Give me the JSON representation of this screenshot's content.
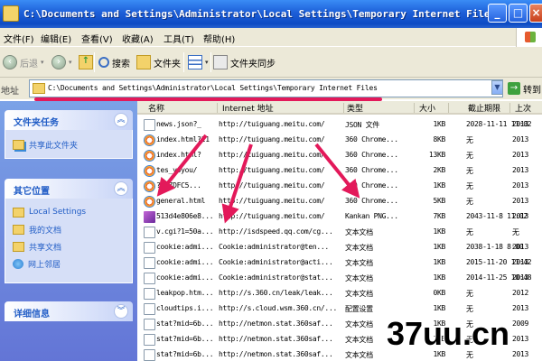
{
  "window": {
    "title": "C:\\Documents and Settings\\Administrator\\Local Settings\\Temporary Internet Files",
    "controls": {
      "minimize": "_",
      "maximize": "□",
      "close": "×"
    }
  },
  "menu": [
    "文件(F)",
    "编辑(E)",
    "查看(V)",
    "收藏(A)",
    "工具(T)",
    "帮助(H)"
  ],
  "toolbar": {
    "back_label": "后退",
    "search_label": "搜索",
    "folders_label": "文件夹",
    "sync_label": "文件夹同步"
  },
  "address": {
    "label": "地址",
    "path": "C:\\Documents and Settings\\Administrator\\Local Settings\\Temporary Internet Files",
    "go_label": "转到"
  },
  "left_pane": {
    "tasks": {
      "title": "文件夹任务",
      "items": [
        "共享此文件夹"
      ]
    },
    "places": {
      "title": "其它位置",
      "items": [
        "Local Settings",
        "我的文档",
        "共享文档",
        "网上邻居"
      ]
    },
    "details": {
      "title": "详细信息"
    }
  },
  "columns": [
    "名称",
    "Internet 地址",
    "类型",
    "大小",
    "截止期限",
    "上次"
  ],
  "files": [
    {
      "icon": "doc-icon",
      "name": "news.json?_",
      "address": "http://tuiguang.meitu.com/",
      "type": "JSON 文件",
      "size": "1KB",
      "expires": "2028-11-11 11:02",
      "last": "2013"
    },
    {
      "icon": "ie-icon",
      "name": "index.html?11",
      "address": "http://tuiguang.meitu.com/",
      "type": "360 Chrome...",
      "size": "8KB",
      "expires": "无",
      "last": "2013"
    },
    {
      "icon": "ie-icon",
      "name": "index.html?",
      "address": "http://tuiguang.meitu.com/",
      "type": "360 Chrome...",
      "size": "13KB",
      "expires": "无",
      "last": "2013"
    },
    {
      "icon": "ie-icon",
      "name": "tes_yoyou/",
      "address": "http://tuiguang.meitu.com/",
      "type": "360 Chrome...",
      "size": "2KB",
      "expires": "无",
      "last": "2013"
    },
    {
      "icon": "ie-icon",
      "name": "?e=7DFC5...",
      "address": "http://tuiguang.meitu.com/",
      "type": "360 Chrome...",
      "size": "1KB",
      "expires": "无",
      "last": "2013"
    },
    {
      "icon": "ie-icon",
      "name": "general.html",
      "address": "http://tuiguang.meitu.com/",
      "type": "360 Chrome...",
      "size": "5KB",
      "expires": "无",
      "last": "2013"
    },
    {
      "icon": "png-icon",
      "name": "513d4e806e8...",
      "address": "http://tuiguang.meitu.com/",
      "type": "Kankan PNG...",
      "size": "7KB",
      "expires": "2043-11-8 11:02",
      "last": "2013"
    },
    {
      "icon": "doc-icon",
      "name": "v.cgi?1=50a...",
      "address": "http://isdspeed.qq.com/cg...",
      "type": "文本文档",
      "size": "1KB",
      "expires": "无",
      "last": "无"
    },
    {
      "icon": "doc-icon",
      "name": "cookie:admi...",
      "address": "Cookie:administrator@ten...",
      "type": "文本文档",
      "size": "1KB",
      "expires": "2038-1-18 8:00",
      "last": "2013"
    },
    {
      "icon": "doc-icon",
      "name": "cookie:admi...",
      "address": "Cookie:administrator@acti...",
      "type": "文本文档",
      "size": "1KB",
      "expires": "2015-11-20 11:42",
      "last": "2013"
    },
    {
      "icon": "doc-icon",
      "name": "cookie:admi...",
      "address": "Cookie:administrator@stat...",
      "type": "文本文档",
      "size": "1KB",
      "expires": "2014-11-25 10:48",
      "last": "2013"
    },
    {
      "icon": "doc-icon",
      "name": "leakpop.htm...",
      "address": "http://s.360.cn/leak/leak...",
      "type": "文本文档",
      "size": "0KB",
      "expires": "无",
      "last": "2012"
    },
    {
      "icon": "doc-icon",
      "name": "cloudtips.i...",
      "address": "http://s.cloud.wsm.360.cn/...",
      "type": "配置设置",
      "size": "1KB",
      "expires": "无",
      "last": "2013"
    },
    {
      "icon": "doc-icon",
      "name": "stat?mid=6b...",
      "address": "http://netmon.stat.360saf...",
      "type": "文本文档",
      "size": "1KB",
      "expires": "无",
      "last": "2009"
    },
    {
      "icon": "doc-icon",
      "name": "stat?mid=6b...",
      "address": "http://netmon.stat.360saf...",
      "type": "文本文档",
      "size": "1KB",
      "expires": "无",
      "last": "2013"
    },
    {
      "icon": "doc-icon",
      "name": "stat?mid=6b...",
      "address": "http://netmon.stat.360saf...",
      "type": "文本文档",
      "size": "1KB",
      "expires": "无",
      "last": "2013"
    }
  ],
  "watermark": "37uu.cn",
  "colors": {
    "title_bar": "#1d5fd8",
    "annotation": "#e3195a",
    "task_pane": "#6375d6"
  }
}
